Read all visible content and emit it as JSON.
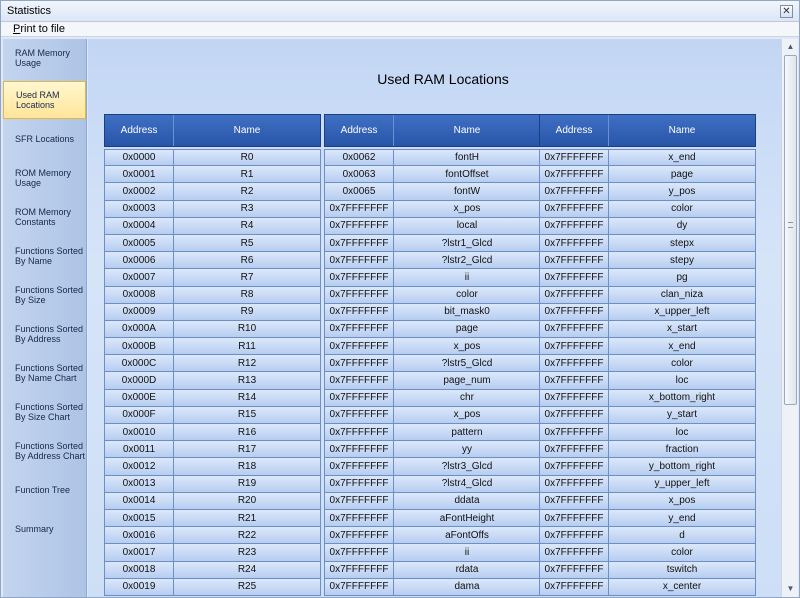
{
  "window": {
    "title": "Statistics",
    "close_glyph": "✕"
  },
  "menu": {
    "print_first": "P",
    "print_rest": "rint to file"
  },
  "sidebar": {
    "items": [
      {
        "label": "RAM Memory Usage"
      },
      {
        "label": "Used RAM Locations"
      },
      {
        "label": "SFR Locations"
      },
      {
        "label": "ROM Memory Usage"
      },
      {
        "label": "ROM Memory Constants"
      },
      {
        "label": "Functions Sorted By  Name"
      },
      {
        "label": "Functions Sorted By Size"
      },
      {
        "label": "Functions Sorted By Address"
      },
      {
        "label": "Functions Sorted By Name Chart"
      },
      {
        "label": "Functions Sorted By Size Chart"
      },
      {
        "label": "Functions Sorted By Address Chart"
      },
      {
        "label": "Function Tree"
      },
      {
        "label": "Summary"
      }
    ]
  },
  "main": {
    "title": "Used RAM Locations",
    "headers": {
      "address": "Address",
      "name": "Name"
    },
    "tables": [
      {
        "rows": [
          [
            "0x0000",
            "R0"
          ],
          [
            "0x0001",
            "R1"
          ],
          [
            "0x0002",
            "R2"
          ],
          [
            "0x0003",
            "R3"
          ],
          [
            "0x0004",
            "R4"
          ],
          [
            "0x0005",
            "R5"
          ],
          [
            "0x0006",
            "R6"
          ],
          [
            "0x0007",
            "R7"
          ],
          [
            "0x0008",
            "R8"
          ],
          [
            "0x0009",
            "R9"
          ],
          [
            "0x000A",
            "R10"
          ],
          [
            "0x000B",
            "R11"
          ],
          [
            "0x000C",
            "R12"
          ],
          [
            "0x000D",
            "R13"
          ],
          [
            "0x000E",
            "R14"
          ],
          [
            "0x000F",
            "R15"
          ],
          [
            "0x0010",
            "R16"
          ],
          [
            "0x0011",
            "R17"
          ],
          [
            "0x0012",
            "R18"
          ],
          [
            "0x0013",
            "R19"
          ],
          [
            "0x0014",
            "R20"
          ],
          [
            "0x0015",
            "R21"
          ],
          [
            "0x0016",
            "R22"
          ],
          [
            "0x0017",
            "R23"
          ],
          [
            "0x0018",
            "R24"
          ],
          [
            "0x0019",
            "R25"
          ]
        ]
      },
      {
        "rows": [
          [
            "0x0062",
            "fontH"
          ],
          [
            "0x0063",
            "fontOffset"
          ],
          [
            "0x0065",
            "fontW"
          ],
          [
            "0x7FFFFFFF",
            "x_pos"
          ],
          [
            "0x7FFFFFFF",
            "local"
          ],
          [
            "0x7FFFFFFF",
            "?lstr1_Glcd"
          ],
          [
            "0x7FFFFFFF",
            "?lstr2_Glcd"
          ],
          [
            "0x7FFFFFFF",
            "ii"
          ],
          [
            "0x7FFFFFFF",
            "color"
          ],
          [
            "0x7FFFFFFF",
            "bit_mask0"
          ],
          [
            "0x7FFFFFFF",
            "page"
          ],
          [
            "0x7FFFFFFF",
            "x_pos"
          ],
          [
            "0x7FFFFFFF",
            "?lstr5_Glcd"
          ],
          [
            "0x7FFFFFFF",
            "page_num"
          ],
          [
            "0x7FFFFFFF",
            "chr"
          ],
          [
            "0x7FFFFFFF",
            "x_pos"
          ],
          [
            "0x7FFFFFFF",
            "pattern"
          ],
          [
            "0x7FFFFFFF",
            "yy"
          ],
          [
            "0x7FFFFFFF",
            "?lstr3_Glcd"
          ],
          [
            "0x7FFFFFFF",
            "?lstr4_Glcd"
          ],
          [
            "0x7FFFFFFF",
            "ddata"
          ],
          [
            "0x7FFFFFFF",
            "aFontHeight"
          ],
          [
            "0x7FFFFFFF",
            "aFontOffs"
          ],
          [
            "0x7FFFFFFF",
            "ii"
          ],
          [
            "0x7FFFFFFF",
            "rdata"
          ],
          [
            "0x7FFFFFFF",
            "dama"
          ]
        ]
      },
      {
        "rows": [
          [
            "0x7FFFFFFF",
            "x_end"
          ],
          [
            "0x7FFFFFFF",
            "page"
          ],
          [
            "0x7FFFFFFF",
            "y_pos"
          ],
          [
            "0x7FFFFFFF",
            "color"
          ],
          [
            "0x7FFFFFFF",
            "dy"
          ],
          [
            "0x7FFFFFFF",
            "stepx"
          ],
          [
            "0x7FFFFFFF",
            "stepy"
          ],
          [
            "0x7FFFFFFF",
            "pg"
          ],
          [
            "0x7FFFFFFF",
            "clan_niza"
          ],
          [
            "0x7FFFFFFF",
            "x_upper_left"
          ],
          [
            "0x7FFFFFFF",
            "x_start"
          ],
          [
            "0x7FFFFFFF",
            "x_end"
          ],
          [
            "0x7FFFFFFF",
            "color"
          ],
          [
            "0x7FFFFFFF",
            "loc"
          ],
          [
            "0x7FFFFFFF",
            "x_bottom_right"
          ],
          [
            "0x7FFFFFFF",
            "y_start"
          ],
          [
            "0x7FFFFFFF",
            "loc"
          ],
          [
            "0x7FFFFFFF",
            "fraction"
          ],
          [
            "0x7FFFFFFF",
            "y_bottom_right"
          ],
          [
            "0x7FFFFFFF",
            "y_upper_left"
          ],
          [
            "0x7FFFFFFF",
            "x_pos"
          ],
          [
            "0x7FFFFFFF",
            "y_end"
          ],
          [
            "0x7FFFFFFF",
            "d"
          ],
          [
            "0x7FFFFFFF",
            "color"
          ],
          [
            "0x7FFFFFFF",
            "tswitch"
          ],
          [
            "0x7FFFFFFF",
            "x_center"
          ]
        ]
      }
    ]
  },
  "scrollbar": {
    "up_glyph": "▲",
    "down_glyph": "▼"
  }
}
